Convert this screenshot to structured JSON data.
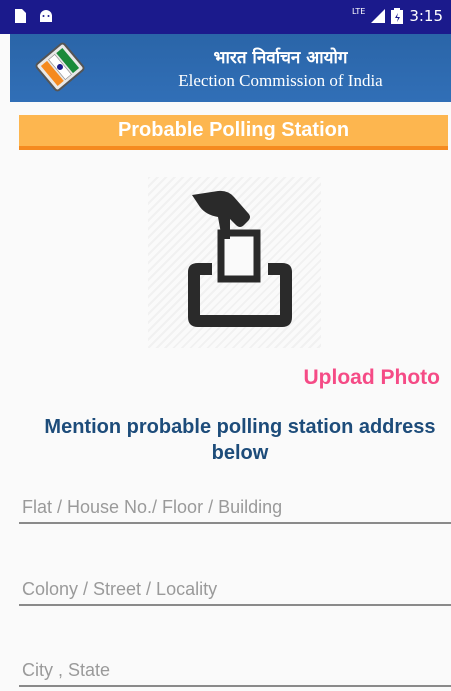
{
  "status_bar": {
    "network": "LTE",
    "time": "3:15",
    "icons": [
      "sd-card-icon",
      "android-icon",
      "signal-icon",
      "battery-icon"
    ]
  },
  "header": {
    "title_hindi": "भारत निर्वाचन आयोग",
    "title_english": "Election Commission of India",
    "logo": "eci-logo-icon"
  },
  "page": {
    "title": "Probable Polling Station",
    "upload_label": "Upload Photo",
    "instruction": "Mention probable polling station address below"
  },
  "form": {
    "fields": [
      {
        "placeholder": "Flat / House No./ Floor / Building",
        "value": ""
      },
      {
        "placeholder": "Colony / Street / Locality",
        "value": ""
      },
      {
        "placeholder": "City , State",
        "value": ""
      }
    ]
  },
  "colors": {
    "status_bar": "#1b1a8c",
    "header": "#2c68ad",
    "title_bar": "#fdb64f",
    "title_underline": "#f58a1f",
    "upload": "#f54b86",
    "instruction": "#1d4c7a"
  }
}
